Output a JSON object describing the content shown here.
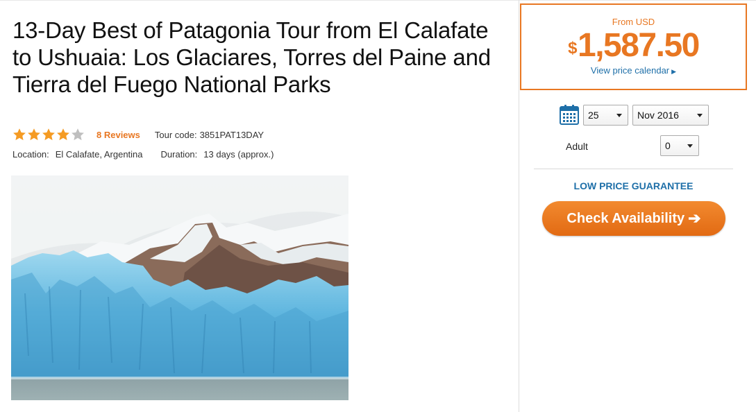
{
  "tour": {
    "title": "13-Day Best of Patagonia Tour from El Calafate to Ushuaia: Los Glaciares, Torres del Paine and Tierra del Fuego National Parks",
    "rating": 4,
    "rating_max": 5,
    "reviews": "8 Reviews",
    "tour_code_label": "Tour code:",
    "tour_code": "3851PAT13DAY",
    "location_label": "Location:",
    "location": "El Calafate, Argentina",
    "duration_label": "Duration:",
    "duration": "13 days (approx.)"
  },
  "price": {
    "from_label": "From USD",
    "currency_symbol": "$",
    "amount": "1,587.50",
    "calendar_link": "View price calendar"
  },
  "booking": {
    "day": "25",
    "month": "Nov 2016",
    "adult_label": "Adult",
    "adult_count": "0",
    "guarantee": "LOW PRICE GUARANTEE",
    "cta": "Check Availability"
  },
  "colors": {
    "accent": "#e87722",
    "link": "#1e6fa8",
    "star_filled": "#f59b23",
    "star_empty": "#bfbfbf"
  },
  "icons": {
    "calendar": "calendar-icon",
    "cta_arrow": "arrow-right-icon",
    "link_arrow": "triangle-right-icon"
  }
}
